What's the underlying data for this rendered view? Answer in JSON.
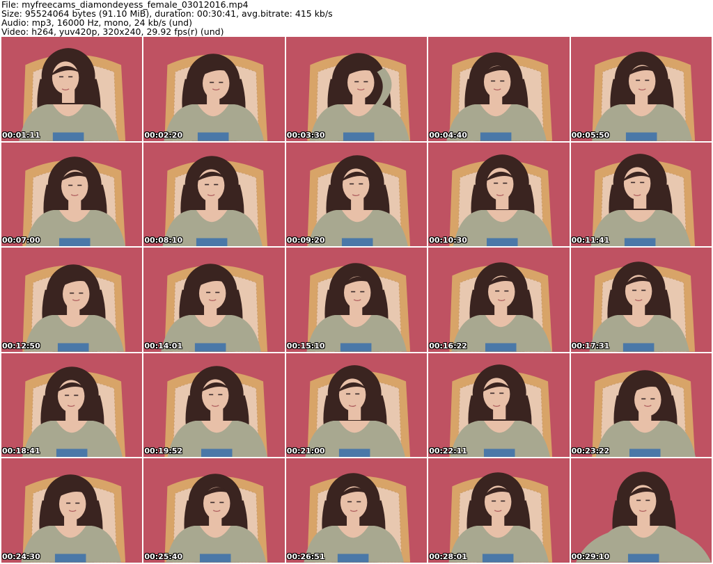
{
  "header": {
    "file_line": "File: myfreecams_diamondeyess_female_03012016.mp4",
    "size_line": "Size: 95524064 bytes (91.10 MiB), duration: 00:30:41, avg.bitrate: 415 kb/s",
    "audio_line": "Audio: mp3, 16000 Hz, mono, 24 kb/s (und)",
    "video_line": "Video: h264, yuv420p, 320x240, 29.92 fps(r) (und)"
  },
  "thumbnails": [
    {
      "timestamp": "00:01:11"
    },
    {
      "timestamp": "00:02:20"
    },
    {
      "timestamp": "00:03:30"
    },
    {
      "timestamp": "00:04:40"
    },
    {
      "timestamp": "00:05:50"
    },
    {
      "timestamp": "00:07:00"
    },
    {
      "timestamp": "00:08:10"
    },
    {
      "timestamp": "00:09:20"
    },
    {
      "timestamp": "00:10:30"
    },
    {
      "timestamp": "00:11:41"
    },
    {
      "timestamp": "00:12:50"
    },
    {
      "timestamp": "00:14:01"
    },
    {
      "timestamp": "00:15:10"
    },
    {
      "timestamp": "00:16:22"
    },
    {
      "timestamp": "00:17:31"
    },
    {
      "timestamp": "00:18:41"
    },
    {
      "timestamp": "00:19:52"
    },
    {
      "timestamp": "00:21:00"
    },
    {
      "timestamp": "00:22:11"
    },
    {
      "timestamp": "00:23:22"
    },
    {
      "timestamp": "00:24:30"
    },
    {
      "timestamp": "00:25:40"
    },
    {
      "timestamp": "00:26:51"
    },
    {
      "timestamp": "00:28:01"
    },
    {
      "timestamp": "00:29:10"
    }
  ],
  "colors": {
    "wall": "#bf5262",
    "chair_frame": "#d8a468",
    "chair_fabric": "#e8c8b0",
    "hair": "#3a2420",
    "skin": "#e8c0a8",
    "cardigan": "#a8a890",
    "top": "#4a78a8"
  }
}
